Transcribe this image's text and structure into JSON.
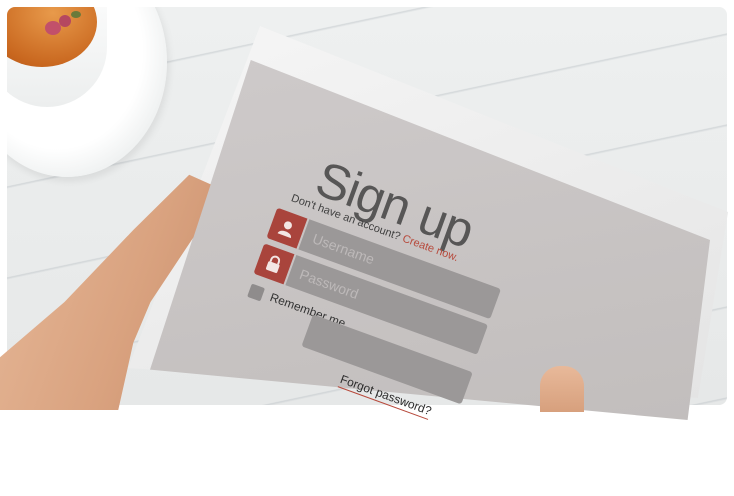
{
  "form": {
    "title": "Sign up",
    "prompt": "Don't have an account?",
    "create_link": "Create now.",
    "username_placeholder": "Username",
    "password_placeholder": "Password",
    "remember_label": "Remember me",
    "forgot_link": "Forgot password?"
  },
  "icons": {
    "username": "user-icon",
    "password": "lock-icon"
  },
  "colors": {
    "accent": "#a9443c",
    "link": "#b7493b",
    "screen": "#c8c4c3",
    "field": "#9b9898"
  }
}
